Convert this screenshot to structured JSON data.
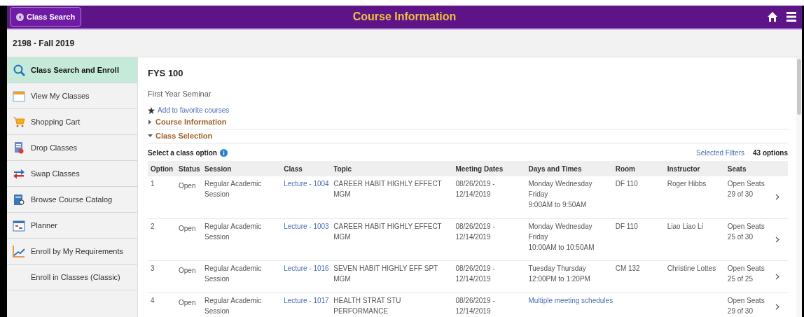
{
  "header": {
    "back_button": "Class Search",
    "title": "Course Information"
  },
  "term": "2198 - Fall 2019",
  "sidebar": {
    "items": [
      {
        "label": "Class Search and Enroll",
        "kind": "search",
        "selected": true
      },
      {
        "label": "View My Classes",
        "kind": "calendar",
        "selected": false
      },
      {
        "label": "Shopping Cart",
        "kind": "cart",
        "selected": false
      },
      {
        "label": "Drop Classes",
        "kind": "drop",
        "selected": false
      },
      {
        "label": "Swap Classes",
        "kind": "swap",
        "selected": false
      },
      {
        "label": "Browse Course Catalog",
        "kind": "catalog",
        "selected": false
      },
      {
        "label": "Planner",
        "kind": "planner",
        "selected": false
      },
      {
        "label": "Enroll by My Requirements",
        "kind": "chart",
        "selected": false
      },
      {
        "label": "Enroll in Classes (Classic)",
        "kind": "none",
        "selected": false
      }
    ]
  },
  "course": {
    "code": "FYS 100",
    "name": "First Year Seminar",
    "favorite_link": "Add to favorite courses",
    "sections": [
      {
        "label": "Course Information",
        "expanded": false
      },
      {
        "label": "Class Selection",
        "expanded": true
      }
    ]
  },
  "class_selection": {
    "prompt": "Select a class option",
    "filters_link": "Selected Filters",
    "count": "43 options",
    "columns": [
      "Option",
      "Status",
      "Session",
      "Class",
      "Topic",
      "Meeting Dates",
      "Days and Times",
      "Room",
      "Instructor",
      "Seats"
    ],
    "rows": [
      {
        "option": "1",
        "status": "Open",
        "session": "Regular Academic Session",
        "class": "Lecture - 1004",
        "topic": "CAREER HABIT HIGHLY EFFECT MGM",
        "dates": "08/26/2019 - 12/14/2019",
        "days": "Monday Wednesday Friday",
        "times": "9:00AM to 9:50AM",
        "room": "DF 110",
        "instructor": "Roger Hibbs",
        "seats": "Open Seats 29 of 30"
      },
      {
        "option": "2",
        "status": "Open",
        "session": "Regular Academic Session",
        "class": "Lecture - 1003",
        "topic": "CAREER HABIT HIGHLY EFFECT MGM",
        "dates": "08/26/2019 - 12/14/2019",
        "days": "Monday Wednesday Friday",
        "times": "10:00AM to 10:50AM",
        "room": "DF 110",
        "instructor": "Liao Liao Li",
        "seats": "Open Seats 25 of 30"
      },
      {
        "option": "3",
        "status": "Open",
        "session": "Regular Academic Session",
        "class": "Lecture - 1016",
        "topic": "SEVEN HABIT HIGHLY EFF SPT MGM",
        "dates": "08/26/2019 - 12/14/2019",
        "days": "Tuesday Thursday",
        "times": "12:00PM to 1:20PM",
        "room": "CM 132",
        "instructor": "Christine Lottes",
        "seats": "Open Seats 25 of 25"
      },
      {
        "option": "4",
        "status": "Open",
        "session": "Regular Academic Session",
        "class": "Lecture - 1017",
        "topic": "HEALTH STRAT STU PERFORMANCE",
        "dates": "08/26/2019 - 12/14/2019",
        "schedule_link": "Multiple meeting schedules",
        "seats": "Open Seats 29 of 30"
      }
    ]
  }
}
